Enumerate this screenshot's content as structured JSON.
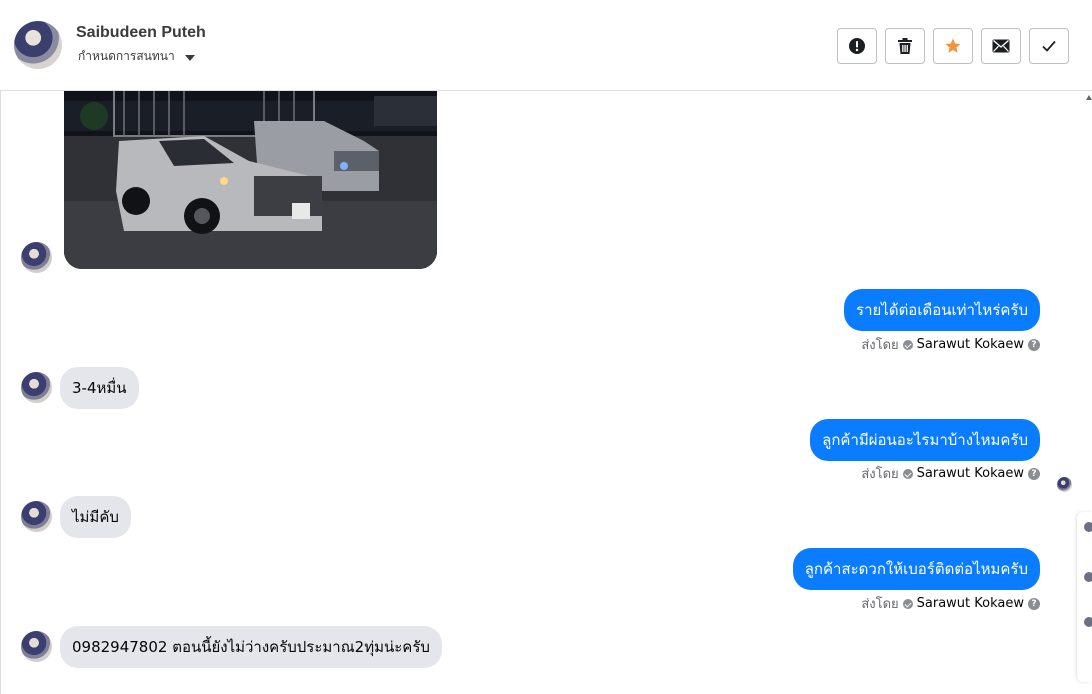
{
  "header": {
    "contact_name": "Saibudeen Puteh",
    "subtitle": "กำหนดการสนทนา",
    "actions": [
      {
        "name": "report-button",
        "icon": "exclamation-circle-icon"
      },
      {
        "name": "delete-button",
        "icon": "trash-icon"
      },
      {
        "name": "star-button",
        "icon": "star-icon",
        "color": "#f5923e"
      },
      {
        "name": "mail-button",
        "icon": "envelope-icon"
      },
      {
        "name": "done-button",
        "icon": "check-icon"
      }
    ]
  },
  "messages": {
    "out_1": "รายได้ต่อเดือนเท่าไหร่ครับ",
    "in_1": "3-4หมื่น",
    "out_2": "ลูกค้ามีผ่อนอะไรมาบ้างไหมครับ",
    "in_2": "ไม่มีคับ",
    "out_3": "ลูกค้าสะดวกให้เบอร์ติดต่อไหมครับ",
    "in_3": "0982947802 ตอนนี้ยังไม่ว่างครับประมาณ2ทุ่มน่ะครับ"
  },
  "sent_by": {
    "label": "ส่งโดย",
    "agent": "Sarawut Kokaew"
  },
  "colors": {
    "outgoing_bubble": "#0a7cff",
    "incoming_bubble": "#e4e6eb"
  }
}
